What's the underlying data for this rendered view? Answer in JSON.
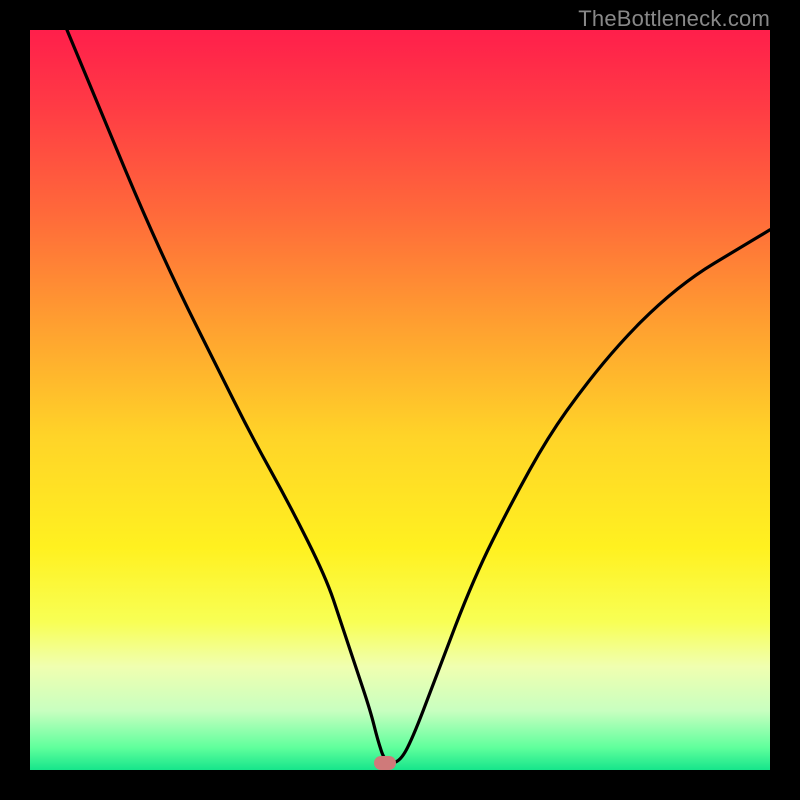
{
  "watermark": "TheBottleneck.com",
  "colors": {
    "marker": "#cf7a7a",
    "curve": "#000000",
    "gradient_stops": [
      {
        "pos": 0.0,
        "color": "#ff1f4b"
      },
      {
        "pos": 0.1,
        "color": "#ff3a45"
      },
      {
        "pos": 0.25,
        "color": "#ff6a3a"
      },
      {
        "pos": 0.4,
        "color": "#ffa030"
      },
      {
        "pos": 0.55,
        "color": "#ffd428"
      },
      {
        "pos": 0.7,
        "color": "#fff120"
      },
      {
        "pos": 0.8,
        "color": "#f8ff55"
      },
      {
        "pos": 0.86,
        "color": "#f0ffb0"
      },
      {
        "pos": 0.92,
        "color": "#c8ffc0"
      },
      {
        "pos": 0.97,
        "color": "#5fff9c"
      },
      {
        "pos": 1.0,
        "color": "#16e58b"
      }
    ]
  },
  "chart_data": {
    "type": "line",
    "title": "",
    "xlabel": "",
    "ylabel": "",
    "xlim": [
      0,
      100
    ],
    "ylim": [
      0,
      100
    ],
    "x": [
      5,
      10,
      15,
      20,
      25,
      30,
      35,
      40,
      42,
      44,
      46,
      47,
      48,
      50,
      52,
      55,
      60,
      65,
      70,
      75,
      80,
      85,
      90,
      95,
      100
    ],
    "values": [
      100,
      88,
      76,
      65,
      55,
      45,
      36,
      26,
      20,
      14,
      8,
      4,
      1,
      1,
      5,
      13,
      26,
      36,
      45,
      52,
      58,
      63,
      67,
      70,
      73
    ],
    "marker": {
      "x": 48,
      "y": 1
    },
    "annotations": []
  }
}
